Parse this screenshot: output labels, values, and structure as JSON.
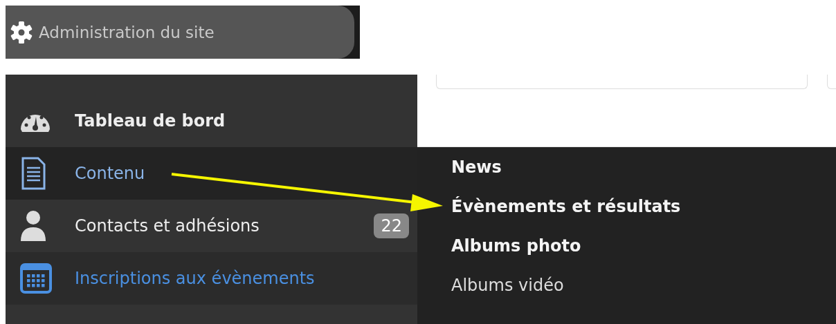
{
  "admin_button": {
    "label": "Administration du site"
  },
  "sidebar": {
    "items": [
      {
        "label": "Tableau de bord",
        "bold": true,
        "accent": false,
        "selected": false
      },
      {
        "label": "Contenu",
        "bold": false,
        "accent": false,
        "selected": true
      },
      {
        "label": "Contacts et adhésions",
        "bold": false,
        "accent": false,
        "selected": false,
        "badge": "22"
      },
      {
        "label": "Inscriptions aux évènements",
        "bold": false,
        "accent": true,
        "selected": false
      }
    ]
  },
  "submenu": {
    "items": [
      {
        "label": "News",
        "bold": true
      },
      {
        "label": "Évènements et résultats",
        "bold": true
      },
      {
        "label": "Albums photo",
        "bold": true
      },
      {
        "label": "Albums vidéo",
        "bold": false
      }
    ]
  }
}
